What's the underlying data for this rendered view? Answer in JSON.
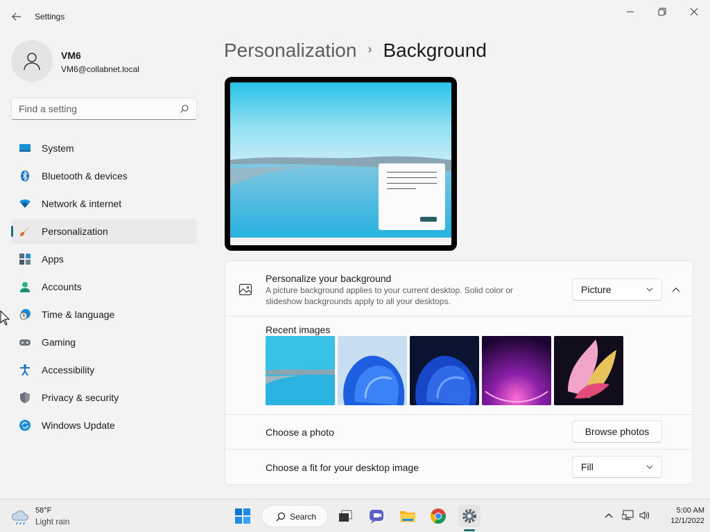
{
  "window": {
    "app_title": "Settings",
    "controls": {
      "minimize_icon": "minimize-icon",
      "maximize_icon": "maximize-icon",
      "close_icon": "close-icon"
    }
  },
  "profile": {
    "name": "VM6",
    "email": "VM6@collabnet.local"
  },
  "search": {
    "placeholder": "Find a setting"
  },
  "nav": {
    "items": [
      {
        "label": "System",
        "icon": "system-icon"
      },
      {
        "label": "Bluetooth & devices",
        "icon": "bluetooth-icon"
      },
      {
        "label": "Network & internet",
        "icon": "network-icon"
      },
      {
        "label": "Personalization",
        "icon": "personalization-icon",
        "active": true
      },
      {
        "label": "Apps",
        "icon": "apps-icon"
      },
      {
        "label": "Accounts",
        "icon": "accounts-icon"
      },
      {
        "label": "Time & language",
        "icon": "time-language-icon"
      },
      {
        "label": "Gaming",
        "icon": "gaming-icon"
      },
      {
        "label": "Accessibility",
        "icon": "accessibility-icon"
      },
      {
        "label": "Privacy & security",
        "icon": "privacy-icon"
      },
      {
        "label": "Windows Update",
        "icon": "windows-update-icon"
      }
    ]
  },
  "breadcrumb": {
    "parent": "Personalization",
    "separator": "›",
    "current": "Background"
  },
  "background": {
    "title": "Personalize your background",
    "description": "A picture background applies to your current desktop. Solid color or slideshow backgrounds apply to all your desktops.",
    "type_value": "Picture",
    "recent_images_label": "Recent images",
    "recent_images": [
      "lake-landscape",
      "blue-bloom-light",
      "blue-bloom-dark",
      "purple-glow",
      "colorful-ribbon"
    ],
    "choose_photo_label": "Choose a photo",
    "browse_button": "Browse photos",
    "fit_label": "Choose a fit for your desktop image",
    "fit_value": "Fill"
  },
  "taskbar": {
    "weather": {
      "temp": "58°F",
      "condition": "Light rain"
    },
    "search_label": "Search",
    "clock": {
      "time": "5:00 AM",
      "date": "12/1/2022"
    }
  },
  "colors": {
    "accent": "#1f6f76",
    "window_bg": "#f3f3f3",
    "card_bg": "#fbfbfb"
  }
}
